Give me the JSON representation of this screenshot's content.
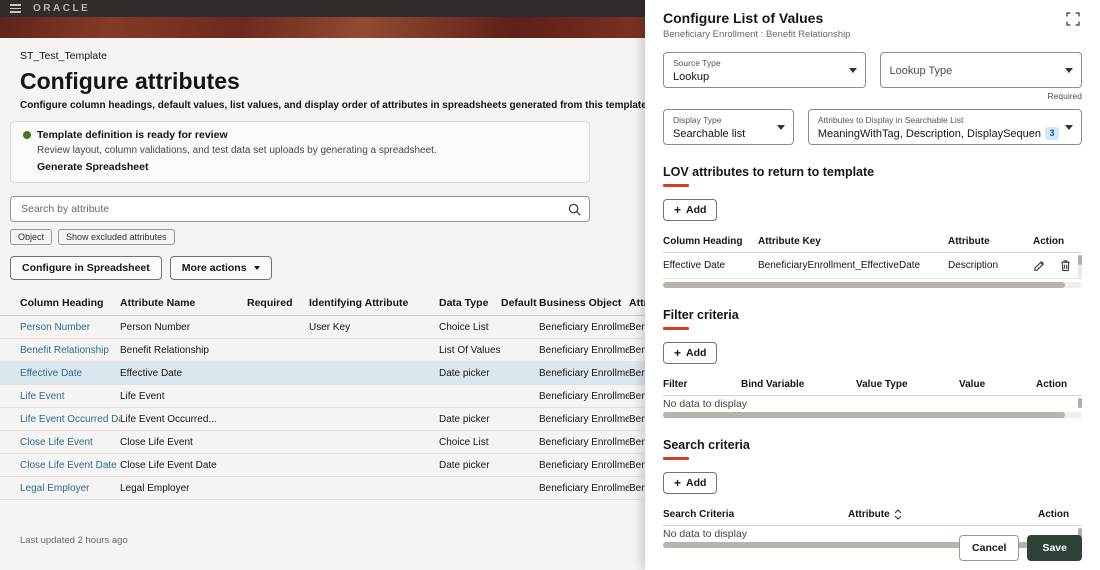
{
  "topbar": {
    "brand": "ORACLE"
  },
  "page": {
    "template_name": "ST_Test_Template",
    "title": "Configure attributes",
    "description": "Configure column headings, default values, list values, and display order of attributes in spreadsheets generated from this template.",
    "last_updated": "Last updated 2 hours ago"
  },
  "notice": {
    "title": "Template definition is ready for review",
    "body": "Review layout, column validations, and test data set uploads by generating a spreadsheet.",
    "action_label": "Generate Spreadsheet"
  },
  "search": {
    "placeholder": "Search by attribute"
  },
  "filters": {
    "object_chip": "Object",
    "excluded_chip": "Show excluded attributes"
  },
  "toolbar": {
    "configure_label": "Configure in Spreadsheet",
    "more_actions_label": "More actions"
  },
  "attributes_table": {
    "columns": [
      "Column Heading",
      "Attribute Name",
      "Required",
      "Identifying Attribute",
      "Data Type",
      "Default",
      "Business Object",
      "Attrib"
    ],
    "rows": [
      {
        "heading": "Person Number",
        "name": "Person Number",
        "required": "",
        "identifying": "User Key",
        "data_type": "Choice List",
        "default": "",
        "business_object": "Beneficiary Enrollment",
        "more": "Benef"
      },
      {
        "heading": "Benefit Relationship",
        "name": "Benefit Relationship",
        "required": "",
        "identifying": "",
        "data_type": "List Of Values",
        "default": "",
        "business_object": "Beneficiary Enrollment",
        "more": "Benef"
      },
      {
        "heading": "Effective Date",
        "name": "Effective Date",
        "required": "",
        "identifying": "",
        "data_type": "Date picker",
        "default": "",
        "business_object": "Beneficiary Enrollment",
        "more": "Benef"
      },
      {
        "heading": "Life Event",
        "name": "Life Event",
        "required": "",
        "identifying": "",
        "data_type": "",
        "default": "",
        "business_object": "Beneficiary Enrollment",
        "more": "Benef"
      },
      {
        "heading": "Life Event Occurred Date",
        "name": "Life Event Occurred...",
        "required": "",
        "identifying": "",
        "data_type": "Date picker",
        "default": "",
        "business_object": "Beneficiary Enrollment",
        "more": "Benef"
      },
      {
        "heading": "Close Life Event",
        "name": "Close Life Event",
        "required": "",
        "identifying": "",
        "data_type": "Choice List",
        "default": "",
        "business_object": "Beneficiary Enrollment",
        "more": "Benef"
      },
      {
        "heading": "Close Life Event Date",
        "name": "Close Life Event Date",
        "required": "",
        "identifying": "",
        "data_type": "Date picker",
        "default": "",
        "business_object": "Beneficiary Enrollment",
        "more": "Benef"
      },
      {
        "heading": "Legal Employer",
        "name": "Legal Employer",
        "required": "",
        "identifying": "",
        "data_type": "",
        "default": "",
        "business_object": "Beneficiary Enrollment",
        "more": "Benef"
      }
    ]
  },
  "panel": {
    "title": "Configure List of Values",
    "subtitle": "Beneficiary Enrollment : Benefit Relationship",
    "fields": {
      "source_type_label": "Source Type",
      "source_type_value": "Lookup",
      "lookup_type_label": "Lookup Type",
      "lookup_type_required": "Required",
      "display_type_label": "Display Type",
      "display_type_value": "Searchable list",
      "display_attrs_label": "Attributes to Display in Searchable List",
      "display_attrs_value": "MeaningWithTag, Description, DisplaySequen",
      "display_attrs_count": "3"
    },
    "lov_section": {
      "title": "LOV attributes to return to template",
      "add_label": "Add",
      "columns": [
        "Column Heading",
        "Attribute Key",
        "Attribute",
        "Action"
      ],
      "row": {
        "column_heading": "Effective Date",
        "attribute_key": "BeneficiaryEnrollment_EffectiveDate",
        "attribute": "Description"
      }
    },
    "filter_section": {
      "title": "Filter criteria",
      "add_label": "Add",
      "columns": [
        "Filter",
        "Bind Variable",
        "Value Type",
        "Value",
        "Action"
      ],
      "empty_text": "No data to display"
    },
    "search_section": {
      "title": "Search criteria",
      "add_label": "Add",
      "columns": [
        "Search Criteria",
        "Attribute",
        "Action"
      ],
      "empty_text": "No data to display"
    },
    "footer": {
      "cancel_label": "Cancel",
      "save_label": "Save"
    }
  },
  "icons": {
    "plus": "+"
  },
  "colors": {
    "accent_red": "#cf4124",
    "link_blue": "#2c6c8d",
    "selected_row": "#dbe7ee",
    "save_button": "#2f4237",
    "badge_blue": "#1458a3",
    "success_green": "#3f7a1f"
  }
}
